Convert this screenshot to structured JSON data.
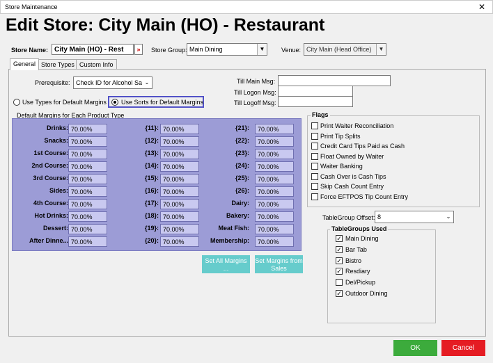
{
  "window": {
    "title": "Store Maintenance",
    "close_glyph": "✕"
  },
  "header": {
    "title": "Edit Store: City Main (HO) - Restaurant"
  },
  "store": {
    "name_label": "Store Name:",
    "name_value": "City Main (HO) - Rest",
    "name_btn": "»",
    "group_label": "Store Group:",
    "group_value": "Main Dining",
    "venue_label": "Venue:",
    "venue_value": "City Main (Head Office)"
  },
  "tabs": [
    "General",
    "Store Types",
    "Custom Info"
  ],
  "general": {
    "prereq_label": "Prerequisite:",
    "prereq_value": "Check ID for Alcohol Sa",
    "till_main_label": "Till Main Msg:",
    "till_logon_label": "Till Logon Msg:",
    "till_logoff_label": "Till Logoff Msg:",
    "till_main_value": "",
    "till_logon_value": "",
    "till_logoff_value": "",
    "radio_types": "Use Types for Default Margins",
    "radio_sorts": "Use Sorts for Default Margins",
    "margins_title": "Default Margins for Each Product Type",
    "margins": [
      [
        {
          "l": "Drinks:",
          "v": "70.00%"
        },
        {
          "l": "{11}:",
          "v": "70.00%"
        },
        {
          "l": "{21}:",
          "v": "70.00%"
        }
      ],
      [
        {
          "l": "Snacks:",
          "v": "70.00%"
        },
        {
          "l": "{12}:",
          "v": "70.00%"
        },
        {
          "l": "{22}:",
          "v": "70.00%"
        }
      ],
      [
        {
          "l": "1st Course:",
          "v": "70.00%"
        },
        {
          "l": "{13}:",
          "v": "70.00%"
        },
        {
          "l": "{23}:",
          "v": "70.00%"
        }
      ],
      [
        {
          "l": "2nd Course:",
          "v": "70.00%"
        },
        {
          "l": "{14}:",
          "v": "70.00%"
        },
        {
          "l": "{24}:",
          "v": "70.00%"
        }
      ],
      [
        {
          "l": "3rd Course:",
          "v": "70.00%"
        },
        {
          "l": "{15}:",
          "v": "70.00%"
        },
        {
          "l": "{25}:",
          "v": "70.00%"
        }
      ],
      [
        {
          "l": "Sides:",
          "v": "70.00%"
        },
        {
          "l": "{16}:",
          "v": "70.00%"
        },
        {
          "l": "{26}:",
          "v": "70.00%"
        }
      ],
      [
        {
          "l": "4th Course:",
          "v": "70.00%"
        },
        {
          "l": "{17}:",
          "v": "70.00%"
        },
        {
          "l": "Dairy:",
          "v": "70.00%"
        }
      ],
      [
        {
          "l": "Hot Drinks:",
          "v": "70.00%"
        },
        {
          "l": "{18}:",
          "v": "70.00%"
        },
        {
          "l": "Bakery:",
          "v": "70.00%"
        }
      ],
      [
        {
          "l": "Dessert:",
          "v": "70.00%"
        },
        {
          "l": "{19}:",
          "v": "70.00%"
        },
        {
          "l": "Meat  Fish:",
          "v": "70.00%"
        }
      ],
      [
        {
          "l": "After Dinne...",
          "v": "70.00%"
        },
        {
          "l": "{20}:",
          "v": "70.00%"
        },
        {
          "l": "Membership:",
          "v": "70.00%"
        }
      ]
    ],
    "btn_set_all": "Set All Margins ...",
    "btn_set_sales": "Set Margins from Sales",
    "flags_title": "Flags",
    "flags": [
      {
        "label": "Print Waiter Reconciliation",
        "checked": false
      },
      {
        "label": "Print Tip Splits",
        "checked": false
      },
      {
        "label": "Credit Card Tips Paid as Cash",
        "checked": false
      },
      {
        "label": "Float Owned by Waiter",
        "checked": false
      },
      {
        "label": "Waiter Banking",
        "checked": false
      },
      {
        "label": "Cash Over is Cash Tips",
        "checked": false
      },
      {
        "label": "Skip Cash Count Entry",
        "checked": false
      },
      {
        "label": "Force EFTPOS Tip Count Entry",
        "checked": false
      }
    ],
    "tg_offset_label": "TableGroup Offset:",
    "tg_offset_value": "8",
    "tg_used_title": "TableGroups Used",
    "tablegroups": [
      {
        "label": "Main Dining",
        "checked": true
      },
      {
        "label": "Bar Tab",
        "checked": true
      },
      {
        "label": "Bistro",
        "checked": true
      },
      {
        "label": "Resdiary",
        "checked": true
      },
      {
        "label": "Del/Pickup",
        "checked": false
      },
      {
        "label": "Outdoor Dining",
        "checked": true
      }
    ]
  },
  "footer": {
    "ok": "OK",
    "cancel": "Cancel"
  },
  "colors": {
    "ok": "#3cab3c",
    "cancel": "#e51c23",
    "teal": "#66cccc",
    "margins_bg": "#9c9cd6"
  }
}
